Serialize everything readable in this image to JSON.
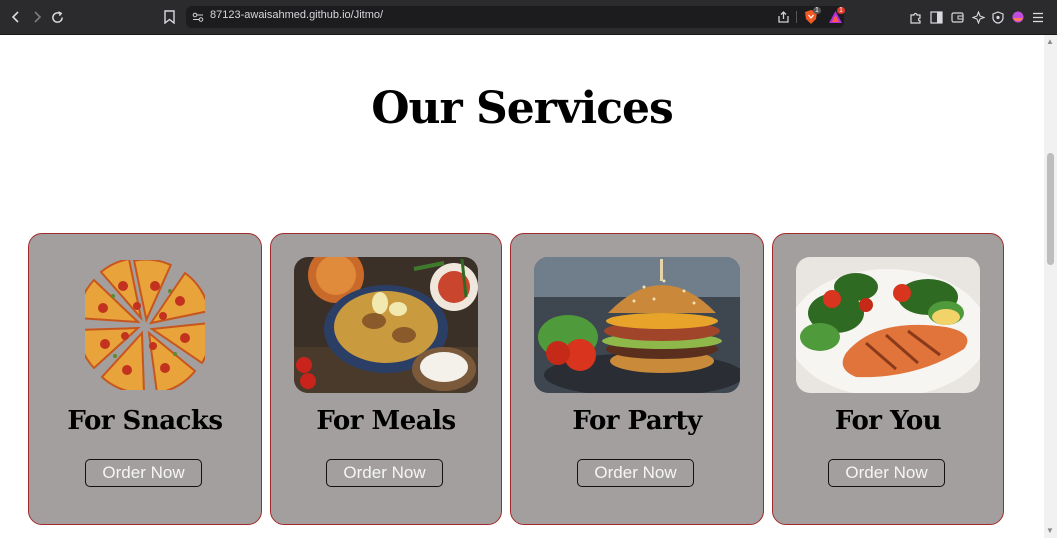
{
  "browser": {
    "url": "87123-awaisahmed.github.io/Jitmo/",
    "shield_badge": "1",
    "rewards_badge": "1"
  },
  "page": {
    "heading": "Our Services",
    "cards": [
      {
        "title": "For Snacks",
        "button": "Order Now",
        "image": "pizza-image"
      },
      {
        "title": "For Meals",
        "button": "Order Now",
        "image": "biryani-image"
      },
      {
        "title": "For Party",
        "button": "Order Now",
        "image": "burger-image"
      },
      {
        "title": "For You",
        "button": "Order Now",
        "image": "salmon-salad-image"
      }
    ]
  },
  "colors": {
    "card_bg": "#a39f9f",
    "card_border": "#a32a2a",
    "chrome_bg": "#2b2b2e"
  }
}
